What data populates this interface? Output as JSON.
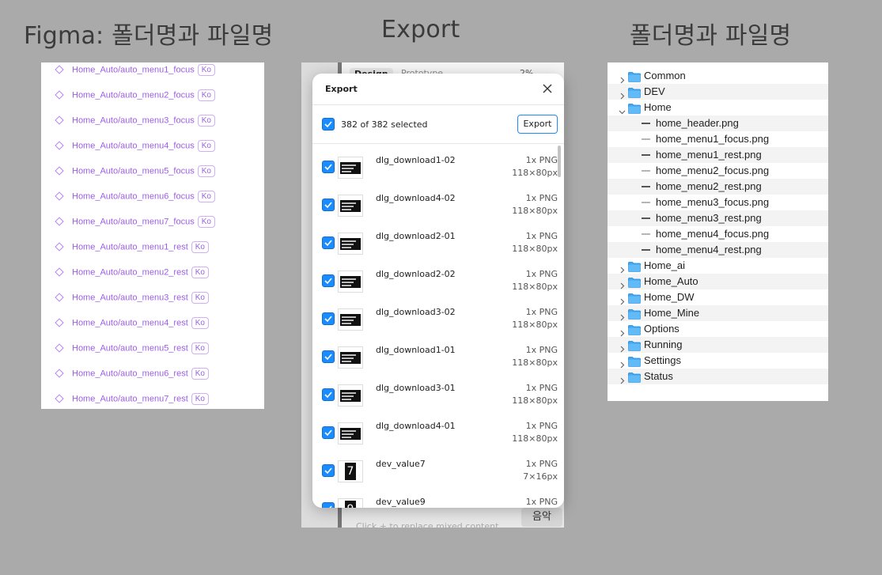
{
  "headings": {
    "figma": "Figma: 폴더명과 파일명",
    "export": "Export",
    "folders": "폴더명과 파일명"
  },
  "figma_list": {
    "badge": "Ko",
    "items": [
      "Home_Auto/auto_menu1_focus",
      "Home_Auto/auto_menu2_focus",
      "Home_Auto/auto_menu3_focus",
      "Home_Auto/auto_menu4_focus",
      "Home_Auto/auto_menu5_focus",
      "Home_Auto/auto_menu6_focus",
      "Home_Auto/auto_menu7_focus",
      "Home_Auto/auto_menu1_rest",
      "Home_Auto/auto_menu2_rest",
      "Home_Auto/auto_menu3_rest",
      "Home_Auto/auto_menu4_rest",
      "Home_Auto/auto_menu5_rest",
      "Home_Auto/auto_menu6_rest",
      "Home_Auto/auto_menu7_rest"
    ]
  },
  "export_dialog": {
    "bg_tab_design": "Design",
    "bg_tab_prototype": "Prototype",
    "bg_zoom": "2%",
    "bg_hint": "Click + to replace mixed content",
    "bg_chip": "음악",
    "title": "Export",
    "selected_text": "382 of 382 selected",
    "export_button": "Export",
    "items": [
      {
        "name": "dlg_download1-02",
        "format": "1x PNG",
        "size": "118×80px",
        "thumb": "text"
      },
      {
        "name": "dlg_download4-02",
        "format": "1x PNG",
        "size": "118×80px",
        "thumb": "text"
      },
      {
        "name": "dlg_download2-01",
        "format": "1x PNG",
        "size": "118×80px",
        "thumb": "text"
      },
      {
        "name": "dlg_download2-02",
        "format": "1x PNG",
        "size": "118×80px",
        "thumb": "text"
      },
      {
        "name": "dlg_download3-02",
        "format": "1x PNG",
        "size": "118×80px",
        "thumb": "text"
      },
      {
        "name": "dlg_download1-01",
        "format": "1x PNG",
        "size": "118×80px",
        "thumb": "text"
      },
      {
        "name": "dlg_download3-01",
        "format": "1x PNG",
        "size": "118×80px",
        "thumb": "text"
      },
      {
        "name": "dlg_download4-01",
        "format": "1x PNG",
        "size": "118×80px",
        "thumb": "text"
      },
      {
        "name": "dev_value7",
        "format": "1x PNG",
        "size": "7×16px",
        "thumb": "7"
      },
      {
        "name": "dev_value9",
        "format": "1x PNG",
        "size": "",
        "thumb": "9"
      }
    ]
  },
  "file_tree": {
    "rows": [
      {
        "label": "Common",
        "type": "folder",
        "expanded": false
      },
      {
        "label": "DEV",
        "type": "folder",
        "expanded": false
      },
      {
        "label": "Home",
        "type": "folder",
        "expanded": true
      },
      {
        "label": "home_header.png",
        "type": "file",
        "light": false
      },
      {
        "label": "home_menu1_focus.png",
        "type": "file",
        "light": true
      },
      {
        "label": "home_menu1_rest.png",
        "type": "file",
        "light": false
      },
      {
        "label": "home_menu2_focus.png",
        "type": "file",
        "light": true
      },
      {
        "label": "home_menu2_rest.png",
        "type": "file",
        "light": false
      },
      {
        "label": "home_menu3_focus.png",
        "type": "file",
        "light": true
      },
      {
        "label": "home_menu3_rest.png",
        "type": "file",
        "light": false
      },
      {
        "label": "home_menu4_focus.png",
        "type": "file",
        "light": true
      },
      {
        "label": "home_menu4_rest.png",
        "type": "file",
        "light": false
      },
      {
        "label": "Home_ai",
        "type": "folder",
        "expanded": false
      },
      {
        "label": "Home_Auto",
        "type": "folder",
        "expanded": false
      },
      {
        "label": "Home_DW",
        "type": "folder",
        "expanded": false
      },
      {
        "label": "Home_Mine",
        "type": "folder",
        "expanded": false
      },
      {
        "label": "Options",
        "type": "folder",
        "expanded": false
      },
      {
        "label": "Running",
        "type": "folder",
        "expanded": false
      },
      {
        "label": "Settings",
        "type": "folder",
        "expanded": false
      },
      {
        "label": "Status",
        "type": "folder",
        "expanded": false
      }
    ]
  },
  "colors": {
    "background": "#aaaaaa",
    "component_purple": "#9b5ee6",
    "checkbox_blue": "#1a8cff",
    "folder_blue": "#3fa9f5"
  }
}
